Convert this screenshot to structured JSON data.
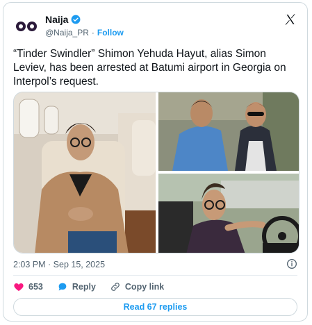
{
  "author": {
    "name": "Naija",
    "handle": "@Naija_PR",
    "separator": "·",
    "follow_label": "Follow"
  },
  "tweet": {
    "text": "“Tinder Swindler” Shimon Yehuda Hayut, alias Simon Leviev, has been arrested at Batumi airport in Georgia on Interpol’s request."
  },
  "meta": {
    "timestamp": "2:03 PM · Sep 15, 2025"
  },
  "actions": {
    "like_count": "653",
    "reply_label": "Reply",
    "copy_link_label": "Copy link"
  },
  "read_replies_label": "Read 67 replies",
  "colors": {
    "accent": "#1d9bf0",
    "like": "#f91880",
    "verified": "#1d9bf0"
  },
  "icons": [
    "naija-logo-icon",
    "verified-badge-icon",
    "x-logo-icon",
    "info-icon",
    "heart-icon",
    "reply-icon",
    "link-icon"
  ]
}
